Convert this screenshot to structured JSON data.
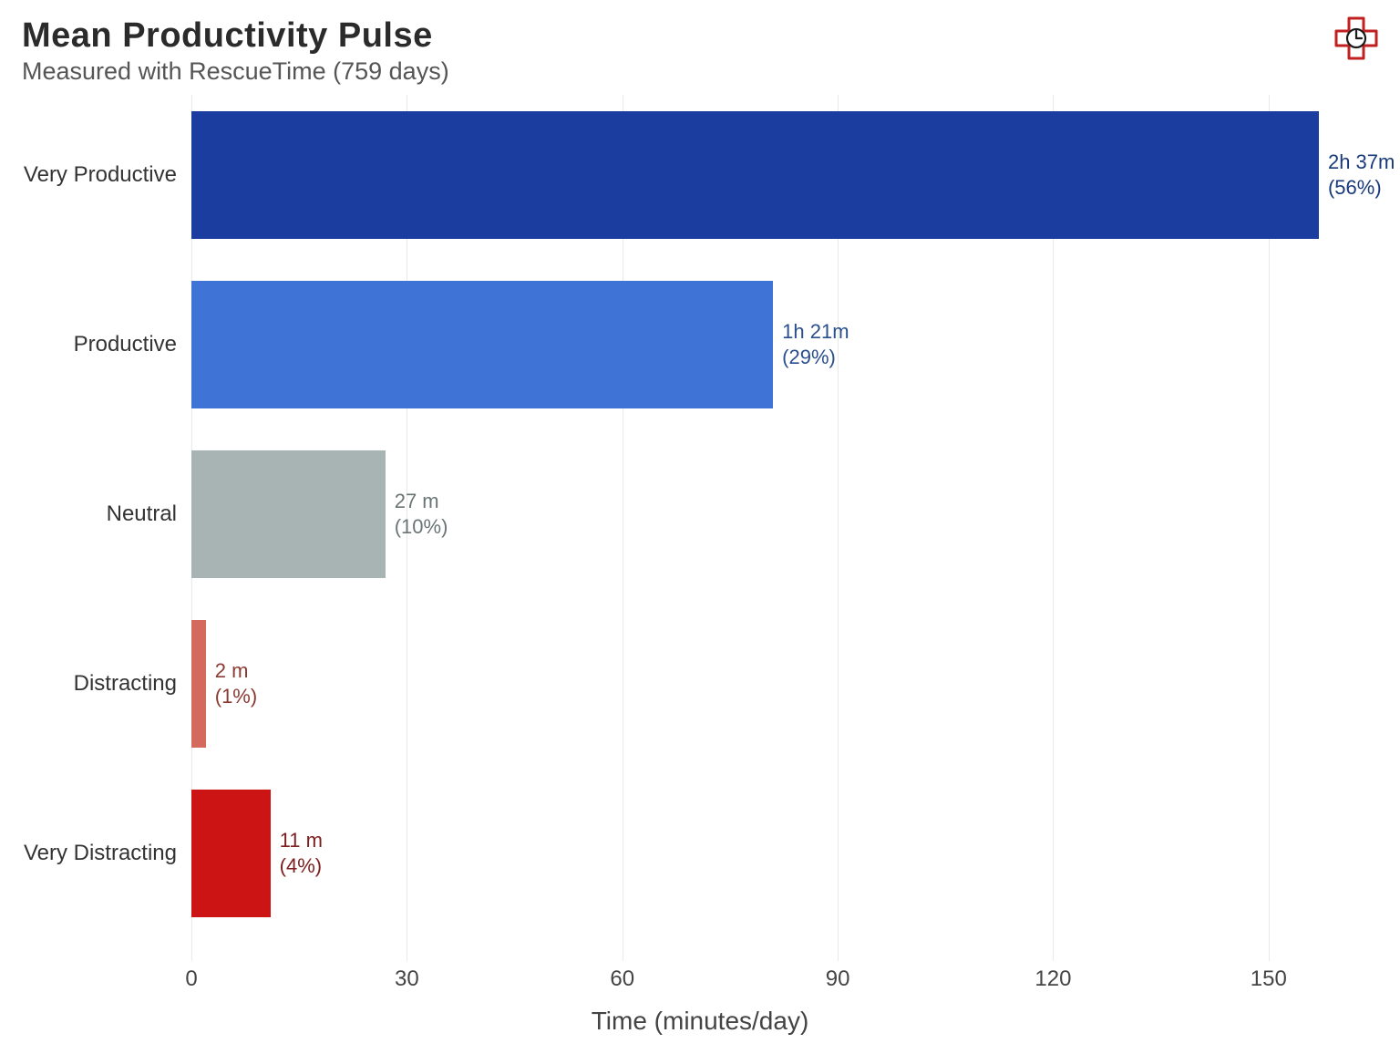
{
  "header": {
    "title": "Mean Productivity Pulse",
    "subtitle": "Measured with RescueTime (759 days)"
  },
  "chart_data": {
    "type": "bar",
    "orientation": "horizontal",
    "xlabel": "Time (minutes/day)",
    "ylabel": "",
    "xlim": [
      0,
      165
    ],
    "x_ticks": [
      0,
      30,
      60,
      90,
      120,
      150
    ],
    "categories": [
      "Very Productive",
      "Productive",
      "Neutral",
      "Distracting",
      "Very Distracting"
    ],
    "series": [
      {
        "name": "minutes_per_day",
        "values": [
          157,
          81,
          27,
          2,
          11
        ]
      }
    ],
    "bars": [
      {
        "category": "Very Productive",
        "minutes": 157,
        "value_label": "2h 37m",
        "percent_label": "(56%)",
        "color": "#1b3d9f",
        "label_color": "#183a7a"
      },
      {
        "category": "Productive",
        "minutes": 81,
        "value_label": "1h 21m",
        "percent_label": "(29%)",
        "color": "#3f74d6",
        "label_color": "#2a4f8e"
      },
      {
        "category": "Neutral",
        "minutes": 27,
        "value_label": "27 m",
        "percent_label": "(10%)",
        "color": "#a7b4b3",
        "label_color": "#6b7575"
      },
      {
        "category": "Distracting",
        "minutes": 2,
        "value_label": "2 m",
        "percent_label": "(1%)",
        "color": "#d36a5d",
        "label_color": "#8a3a30"
      },
      {
        "category": "Very Distracting",
        "minutes": 11,
        "value_label": "11 m",
        "percent_label": "(4%)",
        "color": "#cc1414",
        "label_color": "#7e1d1d"
      }
    ]
  }
}
